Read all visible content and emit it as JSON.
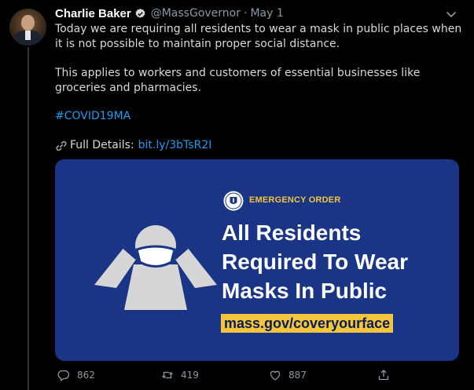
{
  "tweet": {
    "author_name": "Charlie Baker",
    "handle": "@MassGovernor",
    "separator": "·",
    "date": "May 1",
    "text_p1": "Today we are requiring all residents to wear a mask in public places when it is not possible to maintain proper social distance.",
    "text_p2": "This applies to workers and customers of essential businesses like groceries and pharmacies.",
    "hashtag": "#COVID19MA",
    "details_label": "Full Details:",
    "details_link": "bit.ly/3bTsR2I"
  },
  "card": {
    "order_label": "EMERGENCY ORDER",
    "headline_1": "All Residents",
    "headline_2": "Required To Wear",
    "headline_3": "Masks In Public",
    "url": "mass.gov/coveryourface"
  },
  "actions": {
    "replies": "862",
    "retweets": "419",
    "likes": "887"
  },
  "icons": {
    "verified": "verified-badge-icon",
    "caret": "chevron-down-icon",
    "link": "link-icon",
    "reply": "reply-icon",
    "retweet": "retweet-icon",
    "like": "heart-icon",
    "share": "share-icon"
  },
  "colors": {
    "background": "#000000",
    "text": "#d9d9d9",
    "muted": "#8b98a5",
    "link": "#1d9bf0",
    "card_bg": "#1a3586",
    "accent_yellow": "#f2c53d"
  }
}
